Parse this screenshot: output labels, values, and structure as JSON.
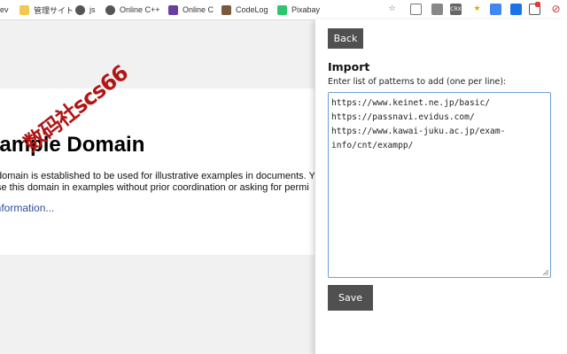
{
  "bookmarks": [
    {
      "label": "ev",
      "icon": "partial-icon"
    },
    {
      "label": "管理サイト",
      "icon": "folder-icon"
    },
    {
      "label": "js",
      "icon": "circle-logo-icon"
    },
    {
      "label": "Online C++",
      "icon": "circle-logo-icon"
    },
    {
      "label": "Online C",
      "icon": "bolt-icon"
    },
    {
      "label": "CodeLog",
      "icon": "codelog-icon"
    },
    {
      "label": "Pixabay",
      "icon": "pixabay-icon"
    }
  ],
  "extensions": [
    "star-icon",
    "pocket-icon",
    "clipboard-icon",
    "crx-icon",
    "bookmark-star-icon",
    "google-icon",
    "translate-icon",
    "save-icon",
    "red-box-icon",
    "block-icon"
  ],
  "background_page": {
    "title": "xample Domain",
    "line1": "domain is established to be used for illustrative examples in documents. Y",
    "line2": "se this domain in examples without prior coordination or asking for permi",
    "link": "information...",
    "watermark": "数码社scs66"
  },
  "popup": {
    "back_label": "Back",
    "import_title": "Import",
    "instructions": "Enter list of patterns to add (one per line):",
    "textarea_lines": [
      "https://www.keinet.ne.jp/basic/",
      "https://passnavi.evidus.com/",
      "https://www.kawai-juku.ac.jp/exam-",
      "info/cnt/exampp/"
    ],
    "save_label": "Save"
  },
  "colors": {
    "button_bg": "#505050",
    "textarea_border": "#6fa0da",
    "link": "#2a4ea3",
    "watermark": "#b21515"
  }
}
